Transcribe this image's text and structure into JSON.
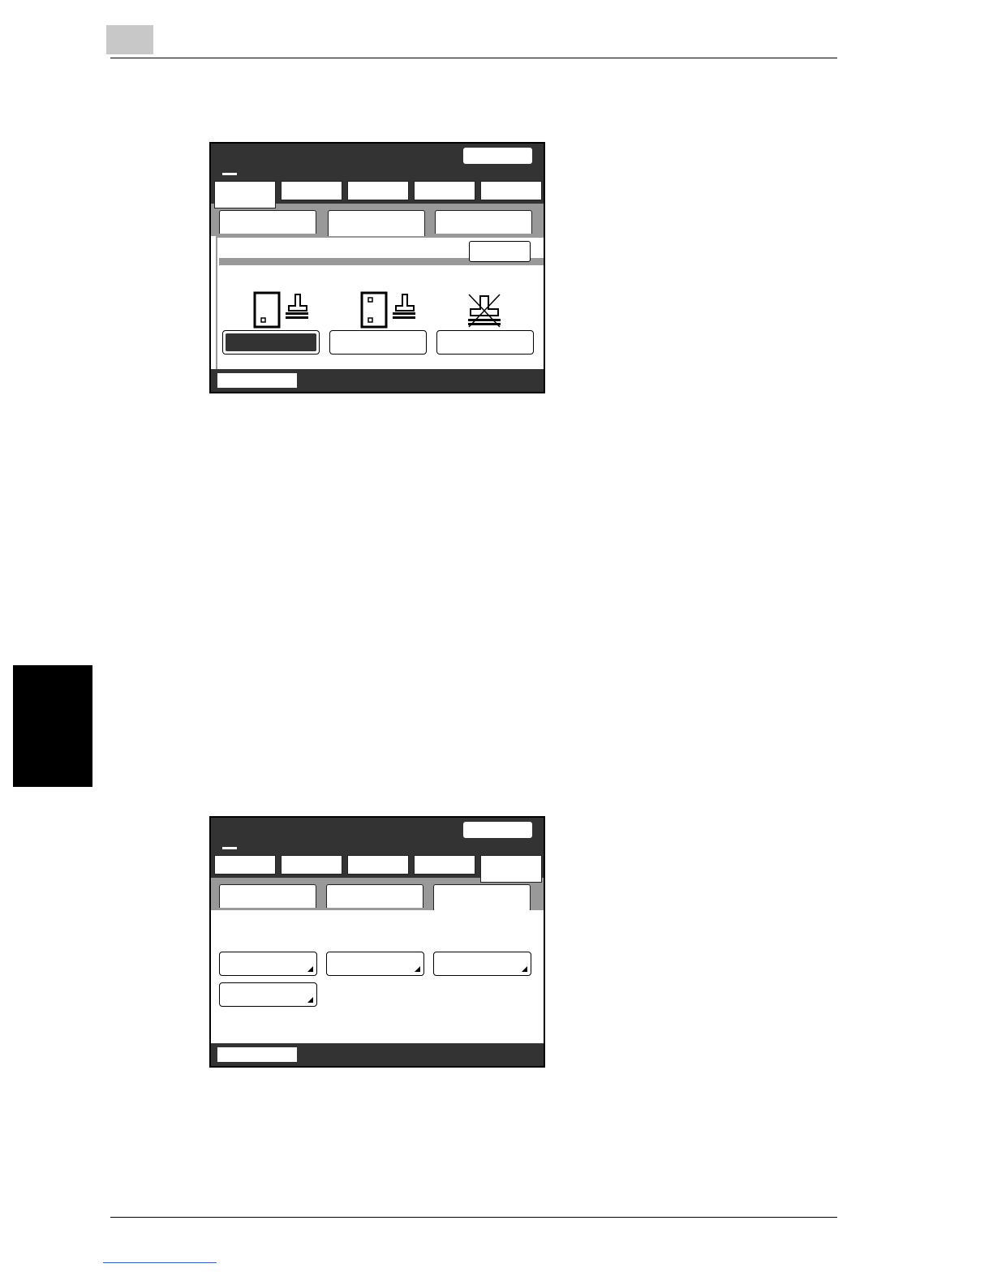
{
  "page": {
    "chapter_badge": "",
    "side_tab": ""
  },
  "screen1": {
    "title": "",
    "top_button": "",
    "tabs": [
      "",
      "",
      "",
      "",
      ""
    ],
    "subtabs": [
      "",
      "",
      ""
    ],
    "close_button": "",
    "options": [
      {
        "icon": "document-staple-corner-icon",
        "label": ""
      },
      {
        "icon": "document-staple-two-point-icon",
        "label": ""
      },
      {
        "icon": "staple-off-icon",
        "label": ""
      }
    ],
    "bottom_button": ""
  },
  "screen2": {
    "title": "",
    "top_button": "",
    "tabs": [
      "",
      "",
      "",
      "",
      ""
    ],
    "subtabs": [
      "",
      "",
      ""
    ],
    "menu_buttons": [
      "",
      "",
      "",
      ""
    ],
    "bottom_button": ""
  }
}
